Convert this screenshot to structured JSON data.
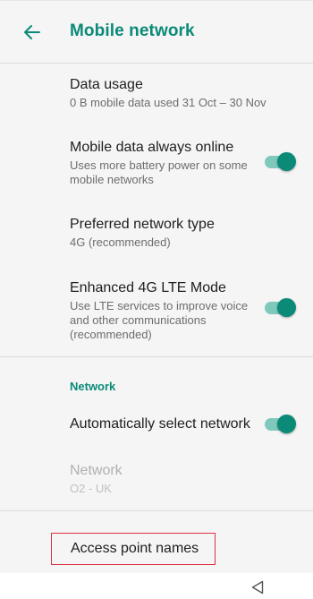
{
  "appbar": {
    "title": "Mobile network",
    "back_icon": "arrow-left-icon"
  },
  "settings": [
    {
      "title": "Data usage",
      "summary": "0 B mobile data used 31 Oct – 30 Nov"
    },
    {
      "title": "Mobile data always online",
      "summary": "Uses more battery power on some mobile networks",
      "toggle": true
    },
    {
      "title": "Preferred network type",
      "summary": "4G (recommended)"
    },
    {
      "title": "Enhanced 4G LTE Mode",
      "summary": "Use LTE services to improve voice and other communications (recommended)",
      "toggle": true
    }
  ],
  "network_section": {
    "header": "Network",
    "auto_select": {
      "title": "Automatically select network",
      "toggle": true
    },
    "network": {
      "title": "Network",
      "summary": "O2 - UK",
      "enabled": false
    }
  },
  "apn": {
    "label": "Access point names"
  },
  "navbar": {
    "back_icon": "triangle-back-icon"
  },
  "colors": {
    "accent": "#0b8a78",
    "toggle_track": "#7fc9bc",
    "highlight_border": "#d9333f",
    "background": "#f5f5f5"
  }
}
